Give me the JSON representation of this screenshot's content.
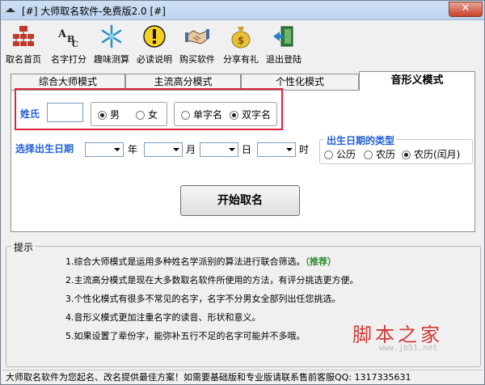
{
  "window": {
    "title": "[#] 大师取名软件-免费版2.0 [#]",
    "close": "✕"
  },
  "toolbar": {
    "items": [
      {
        "label": "取名首页",
        "icon": "home-grid-icon"
      },
      {
        "label": "名字打分",
        "icon": "abc-score-icon"
      },
      {
        "label": "趣味测算",
        "icon": "snowflake-icon"
      },
      {
        "label": "必读说明",
        "icon": "warning-icon"
      },
      {
        "label": "购买软件",
        "icon": "handshake-icon"
      },
      {
        "label": "分享有礼",
        "icon": "money-bag-icon"
      },
      {
        "label": "退出登陆",
        "icon": "exit-door-icon"
      }
    ]
  },
  "tabs": [
    {
      "label": "综合大师模式",
      "active": false
    },
    {
      "label": "主流高分模式",
      "active": false
    },
    {
      "label": "个性化模式",
      "active": false
    },
    {
      "label": "音形义模式",
      "active": true
    }
  ],
  "form": {
    "surname_label": "姓氏",
    "surname_value": "",
    "gender": {
      "options": [
        "男",
        "女"
      ],
      "selected": "男"
    },
    "name_length": {
      "options": [
        "单字名",
        "双字名"
      ],
      "selected": "双字名"
    },
    "birth_label": "选择出生日期",
    "date_units": [
      "年",
      "月",
      "日",
      "时"
    ],
    "calendar_type": {
      "legend": "出生日期的类型",
      "options": [
        "公历",
        "农历",
        "农历(闰月)"
      ],
      "selected": "农历(闰月)"
    },
    "start_button": "开始取名"
  },
  "hints": {
    "legend": "提示",
    "items": [
      {
        "text": "1.综合大师模式是运用多种姓名学派别的算法进行联合筛选。",
        "badge": "（推荐）"
      },
      {
        "text": "2.主流高分模式是现在大多数取名软件所使用的方法，有评分挑选更方便。"
      },
      {
        "text": "3.个性化模式有很多不常见的名字，名字不分男女全部列出任您挑选。"
      },
      {
        "text": "4.音形义模式更加注重名字的读音、形状和意义。"
      },
      {
        "text": "5.如果设置了辈份字，能弥补五行不足的名字可能并不多哦。"
      }
    ]
  },
  "watermark": {
    "text": "脚本之家",
    "url": "www.jb51.net"
  },
  "status": "大师取名软件为您起名、改名提供最佳方案！如需要基础版和专业版请联系售前客服QQ: 1317335631",
  "colors": {
    "accent_blue": "#1f5fd6",
    "highlight_red": "#e0223a",
    "recommend_green": "#2e8b2e"
  }
}
